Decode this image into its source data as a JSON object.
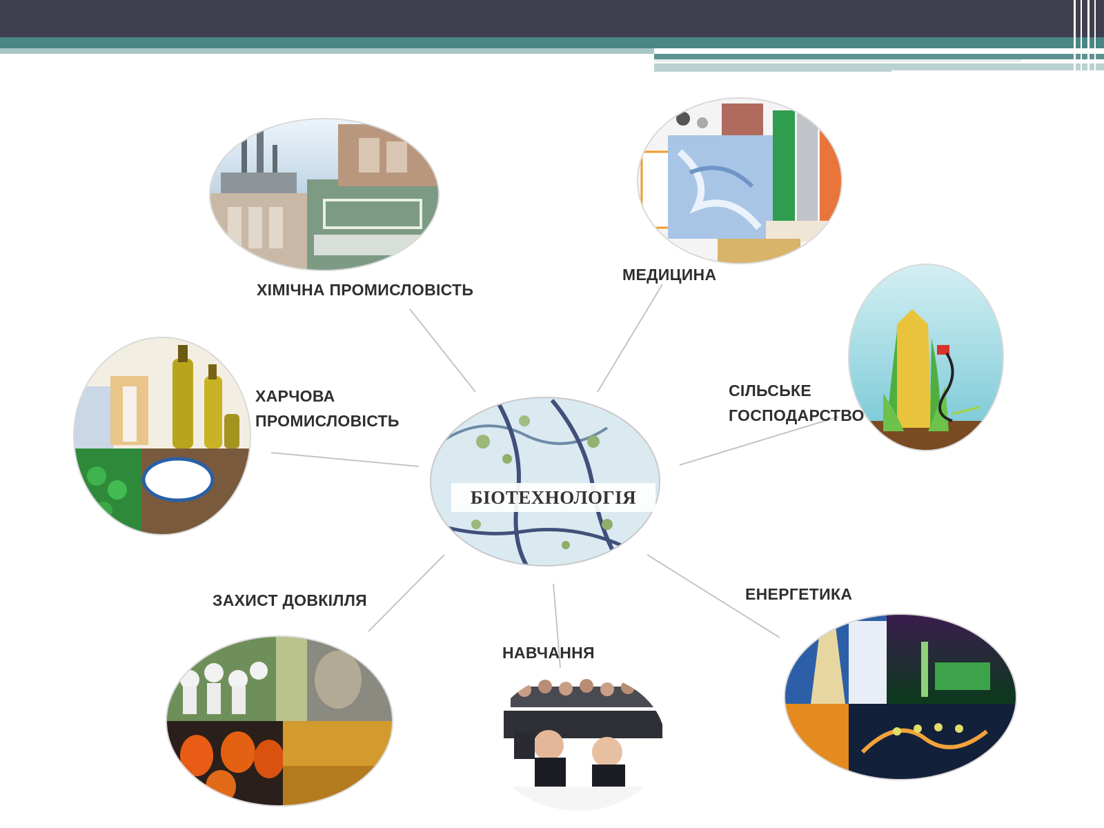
{
  "center": {
    "label": "БІОТЕХНОЛОГІЯ"
  },
  "labels": {
    "chemical": "ХІМІЧНА ПРОМИСЛОВІСТЬ",
    "medicine": "МЕДИЦИНА",
    "food_line1": "ХАРЧОВА",
    "food_line2": "ПРОМИСЛОВІСТЬ",
    "agriculture_line1": "СІЛЬСЬКЕ",
    "agriculture_line2": "ГОСПОДАРСТВО",
    "environment": "ЗАХИСТ ДОВКІЛЛЯ",
    "education": "НАВЧАННЯ",
    "energy": "ЕНЕРГЕТИКА"
  },
  "colors": {
    "header_dark": "#3f3f4f",
    "header_teal": "#4b8585",
    "connector": "#c4c4c4",
    "label_text": "#2f2f2f"
  },
  "icons": [
    "chemical-plant-photo-icon",
    "medicine-lab-photo-icon",
    "food-oil-bottles-photo-icon",
    "corn-fuel-photo-icon",
    "cell-microscope-photo-icon",
    "environment-collage-photo-icon",
    "students-photo-icon",
    "energy-plant-photo-icon"
  ]
}
